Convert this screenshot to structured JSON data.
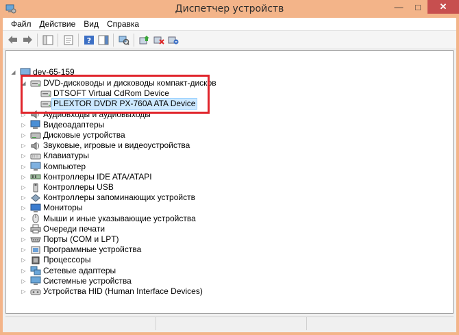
{
  "window": {
    "title": "Диспетчер устройств"
  },
  "menu": [
    "Файл",
    "Действие",
    "Вид",
    "Справка"
  ],
  "toolbar_icons": [
    "back-arrow-icon",
    "forward-arrow-icon",
    "console-tree-icon",
    "properties-icon",
    "help-icon",
    "action-pane-icon",
    "scan-hardware-icon",
    "update-driver-icon",
    "disable-device-icon",
    "uninstall-device-icon"
  ],
  "tree": {
    "root": "dev-65-159",
    "items": [
      {
        "label": "DVD-дисководы и дисководы компакт-дисков",
        "icon": "dvd-drive-icon",
        "expanded": true,
        "children": [
          {
            "label": "DTSOFT Virtual CdRom Device",
            "icon": "dvd-drive-icon"
          },
          {
            "label": "PLEXTOR DVDR   PX-760A ATA Device",
            "icon": "dvd-drive-icon",
            "selected": true
          }
        ]
      },
      {
        "label": "Аудиовходы и аудиовыходы",
        "icon": "speaker-icon"
      },
      {
        "label": "Видеоадаптеры",
        "icon": "display-adapter-icon"
      },
      {
        "label": "Дисковые устройства",
        "icon": "disk-drive-icon"
      },
      {
        "label": "Звуковые, игровые и видеоустройства",
        "icon": "sound-icon"
      },
      {
        "label": "Клавиатуры",
        "icon": "keyboard-icon"
      },
      {
        "label": "Компьютер",
        "icon": "computer-icon"
      },
      {
        "label": "Контроллеры IDE ATA/ATAPI",
        "icon": "ide-controller-icon"
      },
      {
        "label": "Контроллеры USB",
        "icon": "usb-icon"
      },
      {
        "label": "Контроллеры запоминающих устройств",
        "icon": "storage-controller-icon"
      },
      {
        "label": "Мониторы",
        "icon": "monitor-icon"
      },
      {
        "label": "Мыши и иные указывающие устройства",
        "icon": "mouse-icon"
      },
      {
        "label": "Очереди печати",
        "icon": "printer-icon"
      },
      {
        "label": "Порты (COM и LPT)",
        "icon": "port-icon"
      },
      {
        "label": "Программные устройства",
        "icon": "software-device-icon"
      },
      {
        "label": "Процессоры",
        "icon": "processor-icon"
      },
      {
        "label": "Сетевые адаптеры",
        "icon": "network-adapter-icon"
      },
      {
        "label": "Системные устройства",
        "icon": "system-device-icon"
      },
      {
        "label": "Устройства HID (Human Interface Devices)",
        "icon": "hid-icon"
      }
    ]
  },
  "colors": {
    "frame": "#f3b489",
    "close": "#c74f4f",
    "highlight": "#e0242b",
    "selection": "#cce8ff"
  }
}
